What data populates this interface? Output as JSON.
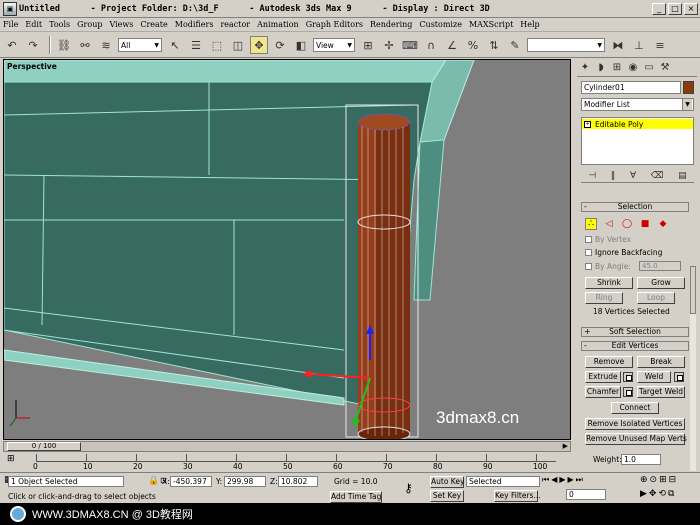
{
  "title": {
    "text": "Untitled      - Project Folder: D:\\3d_F      - Autodesk 3ds Max 9      - Display : Direct 3D"
  },
  "menu": [
    "File",
    "Edit",
    "Tools",
    "Group",
    "Views",
    "Create",
    "Modifiers",
    "reactor",
    "Animation",
    "Graph Editors",
    "Rendering",
    "Customize",
    "MAXScript",
    "Help"
  ],
  "toolbar": {
    "filter": "All",
    "coord": "View"
  },
  "viewport": {
    "label": "Perspective",
    "watermark": "3dmax8.cn"
  },
  "command_panel": {
    "object_name": "Cylinder01",
    "object_color": "#8b3a0f",
    "modifier_list": "Modifier List",
    "stack_item": "Editable Poly",
    "selection": {
      "title": "Selection",
      "by_vertex": "By Vertex",
      "ignore_backfacing": "Ignore Backfacing",
      "by_angle": "By Angle:",
      "angle_value": "45.0",
      "shrink": "Shrink",
      "grow": "Grow",
      "ring": "Ring",
      "loop": "Loop",
      "status": "18 Vertices Selected"
    },
    "soft_selection": "Soft Selection",
    "edit_vertices": {
      "title": "Edit Vertices",
      "remove": "Remove",
      "break": "Break",
      "extrude": "Extrude",
      "weld": "Weld",
      "chamfer": "Chamfer",
      "target_weld": "Target Weld",
      "connect": "Connect",
      "remove_isolated": "Remove Isolated Vertices",
      "remove_unused": "Remove Unused Map Verts",
      "weight_label": "Weight:",
      "weight_value": "1.0"
    }
  },
  "timeline": {
    "frame": "0 / 100",
    "ticks": [
      "0",
      "10",
      "20",
      "30",
      "40",
      "50",
      "60",
      "70",
      "80",
      "90",
      "100"
    ]
  },
  "status": {
    "selected": "1 Object Selected",
    "prompt": "Click or click-and-drag to select objects",
    "x": "-450.397",
    "y": "299.98",
    "z": "10.802",
    "grid": "Grid = 10.0",
    "add_time_tag": "Add Time Tag",
    "auto_key": "Auto Key",
    "set_key": "Set Key",
    "key_mode": "Selected",
    "key_filters": "Key Filters...",
    "current_frame": "0"
  },
  "footer": {
    "text": "WWW.3DMAX8.CN @ 3D教程网"
  }
}
